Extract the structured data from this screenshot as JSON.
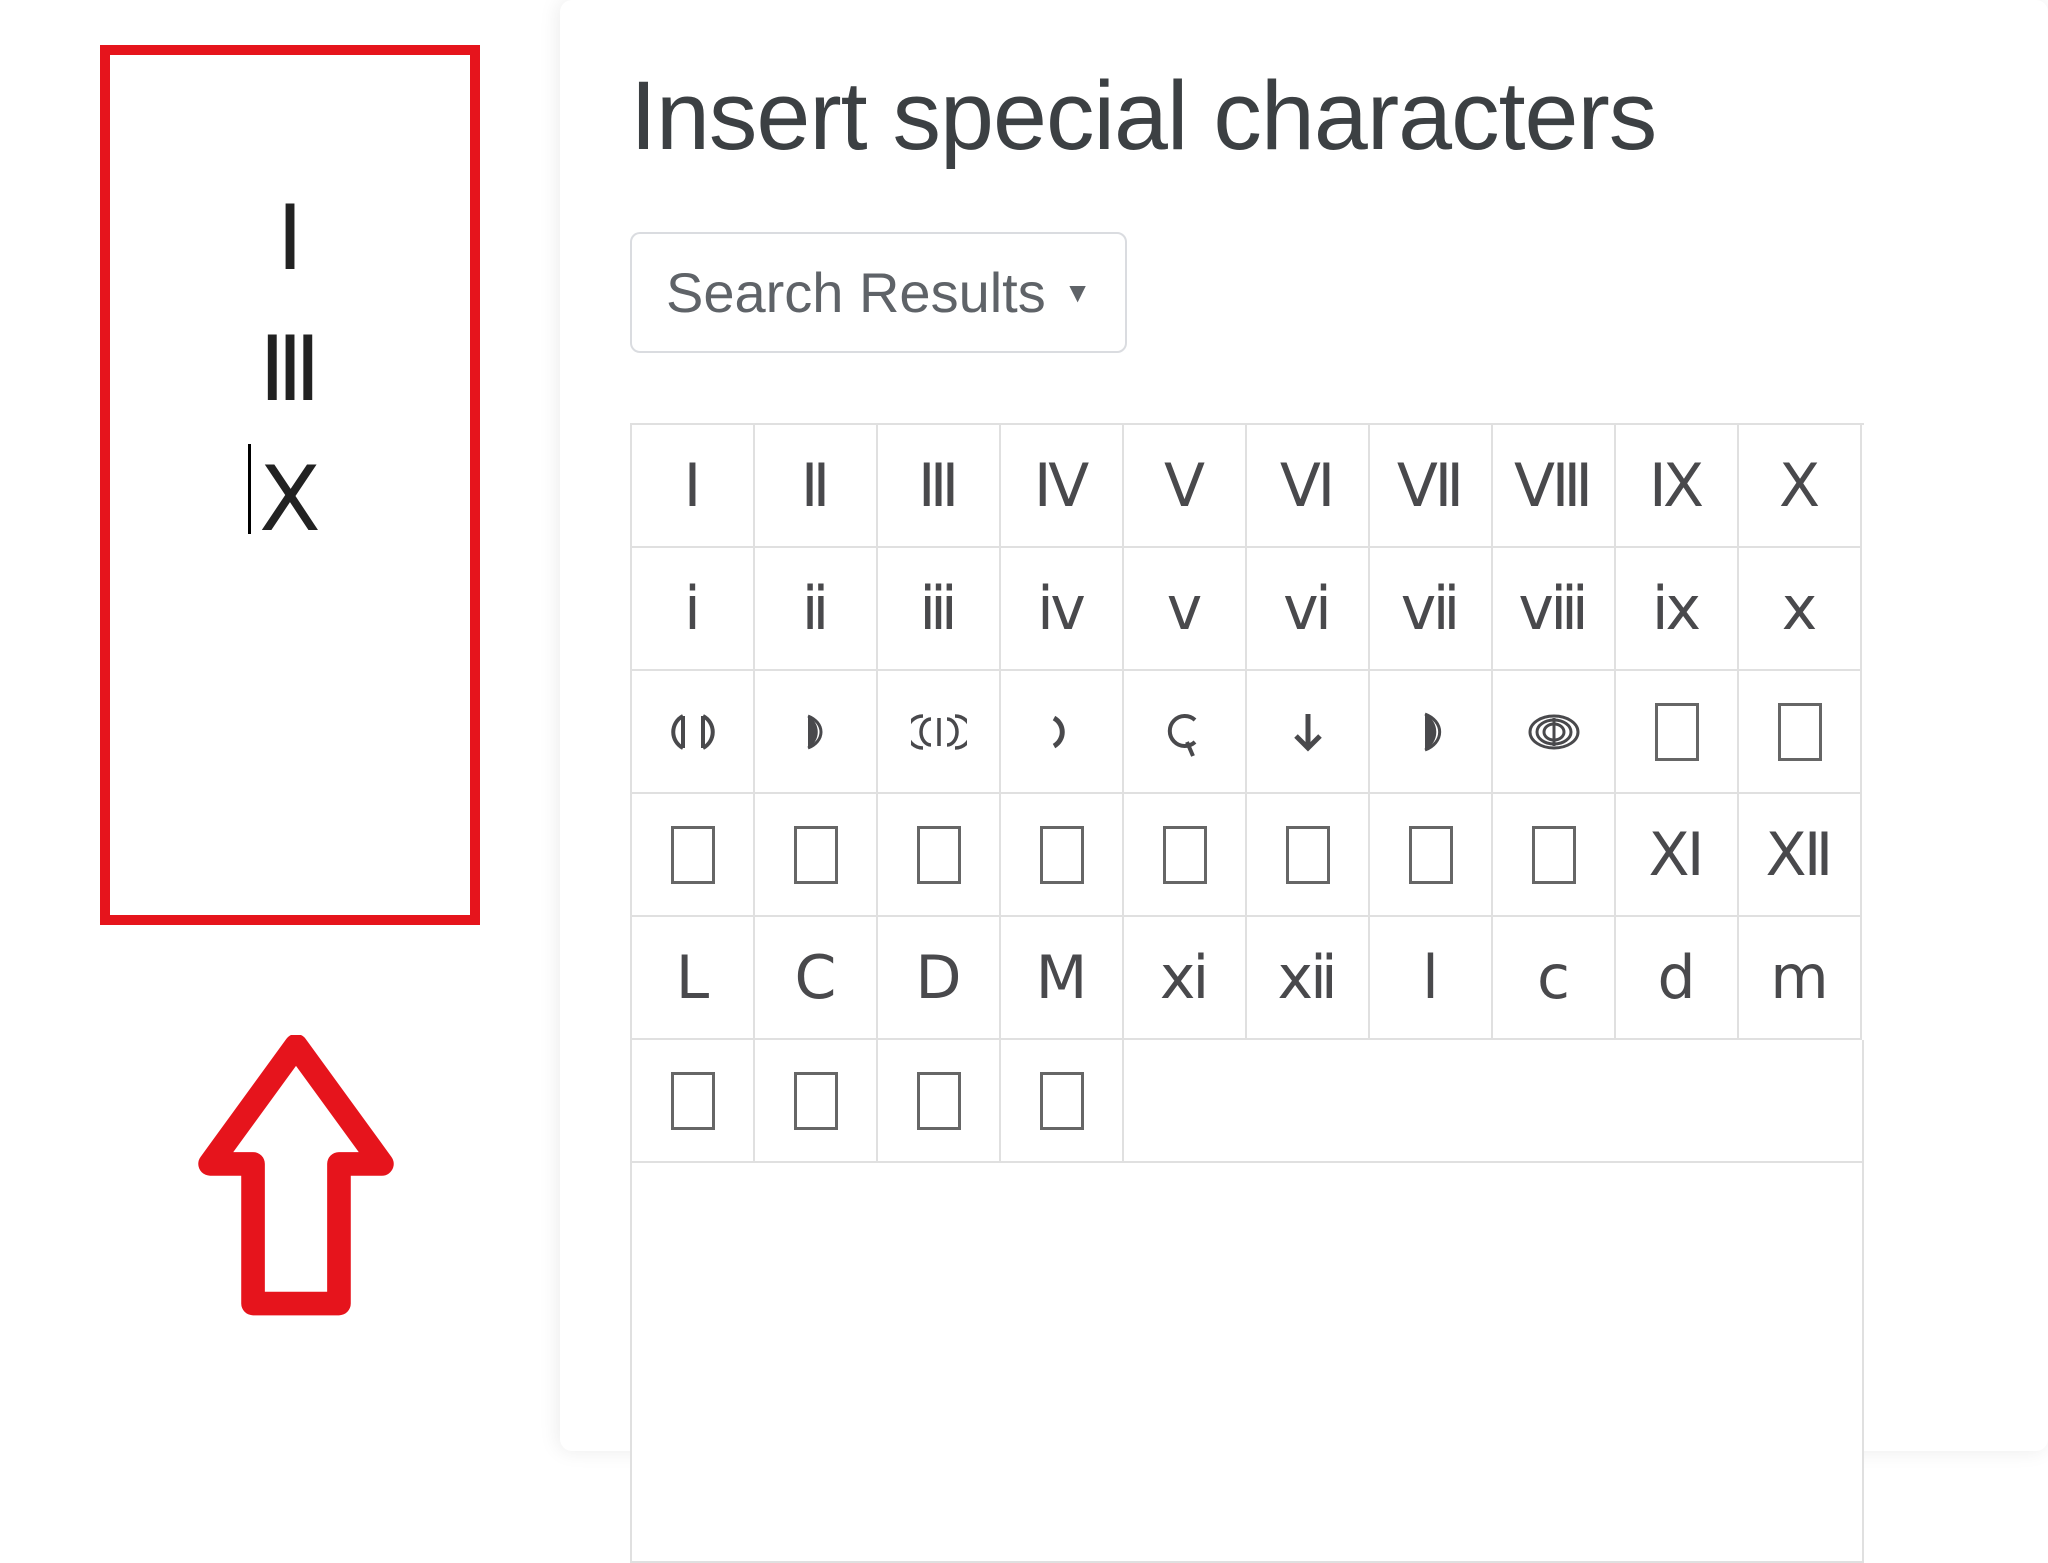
{
  "document": {
    "lines": [
      "Ⅰ",
      "Ⅲ",
      "Ⅹ"
    ]
  },
  "dialog": {
    "title": "Insert special characters",
    "category_label": "Search Results",
    "grid": [
      [
        {
          "g": "Ⅰ",
          "n": "roman-numeral-one"
        },
        {
          "g": "Ⅱ",
          "n": "roman-numeral-two"
        },
        {
          "g": "Ⅲ",
          "n": "roman-numeral-three"
        },
        {
          "g": "Ⅳ",
          "n": "roman-numeral-four"
        },
        {
          "g": "Ⅴ",
          "n": "roman-numeral-five"
        },
        {
          "g": "Ⅵ",
          "n": "roman-numeral-six"
        },
        {
          "g": "Ⅶ",
          "n": "roman-numeral-seven"
        },
        {
          "g": "Ⅷ",
          "n": "roman-numeral-eight"
        },
        {
          "g": "Ⅸ",
          "n": "roman-numeral-nine"
        },
        {
          "g": "Ⅹ",
          "n": "roman-numeral-ten"
        }
      ],
      [
        {
          "g": "ⅰ",
          "n": "small-roman-numeral-one"
        },
        {
          "g": "ⅱ",
          "n": "small-roman-numeral-two"
        },
        {
          "g": "ⅲ",
          "n": "small-roman-numeral-three"
        },
        {
          "g": "ⅳ",
          "n": "small-roman-numeral-four"
        },
        {
          "g": "ⅴ",
          "n": "small-roman-numeral-five"
        },
        {
          "g": "ⅵ",
          "n": "small-roman-numeral-six"
        },
        {
          "g": "ⅶ",
          "n": "small-roman-numeral-seven"
        },
        {
          "g": "ⅷ",
          "n": "small-roman-numeral-eight"
        },
        {
          "g": "ⅸ",
          "n": "small-roman-numeral-nine"
        },
        {
          "g": "ⅹ",
          "n": "small-roman-numeral-ten"
        }
      ],
      [
        {
          "svg": "cd",
          "n": "roman-numeral-one-hundred-thousand"
        },
        {
          "svg": "halfmoon",
          "n": "roman-numeral-five-thousand"
        },
        {
          "svg": "double-cd",
          "n": "roman-numeral-ten-thousand"
        },
        {
          "svg": "reverse-c",
          "n": "roman-numeral-reversed-hundred"
        },
        {
          "svg": "c-tail",
          "n": "roman-siliqua-sign"
        },
        {
          "svg": "down-arrow",
          "n": "roman-quinarius-sign"
        },
        {
          "svg": "halfmoon-dark",
          "n": "roman-numeral-fifty-thousand"
        },
        {
          "svg": "triple-cd",
          "n": "roman-numeral-one-hundred-thousand-alt"
        },
        {
          "tofu": true,
          "n": "unknown-glyph-1"
        },
        {
          "tofu": true,
          "n": "unknown-glyph-2"
        }
      ],
      [
        {
          "tofu": true,
          "n": "unknown-glyph-3"
        },
        {
          "tofu": true,
          "n": "unknown-glyph-4"
        },
        {
          "tofu": true,
          "n": "unknown-glyph-5"
        },
        {
          "tofu": true,
          "n": "unknown-glyph-6"
        },
        {
          "tofu": true,
          "n": "unknown-glyph-7"
        },
        {
          "tofu": true,
          "n": "unknown-glyph-8"
        },
        {
          "tofu": true,
          "n": "unknown-glyph-9"
        },
        {
          "tofu": true,
          "n": "unknown-glyph-10"
        },
        {
          "g": "Ⅺ",
          "n": "roman-numeral-eleven"
        },
        {
          "g": "Ⅻ",
          "n": "roman-numeral-twelve"
        }
      ],
      [
        {
          "g": "Ⅼ",
          "n": "roman-numeral-fifty"
        },
        {
          "g": "Ⅽ",
          "n": "roman-numeral-one-hundred"
        },
        {
          "g": "Ⅾ",
          "n": "roman-numeral-five-hundred"
        },
        {
          "g": "Ⅿ",
          "n": "roman-numeral-one-thousand"
        },
        {
          "g": "ⅺ",
          "n": "small-roman-numeral-eleven"
        },
        {
          "g": "ⅻ",
          "n": "small-roman-numeral-twelve"
        },
        {
          "g": "ⅼ",
          "n": "small-roman-numeral-fifty"
        },
        {
          "g": "ⅽ",
          "n": "small-roman-numeral-one-hundred"
        },
        {
          "g": "ⅾ",
          "n": "small-roman-numeral-five-hundred"
        },
        {
          "g": "ⅿ",
          "n": "small-roman-numeral-one-thousand"
        }
      ],
      [
        {
          "tofu": true,
          "n": "unknown-glyph-11"
        },
        {
          "tofu": true,
          "n": "unknown-glyph-12"
        },
        {
          "tofu": true,
          "n": "unknown-glyph-13"
        },
        {
          "tofu": true,
          "n": "unknown-glyph-14"
        }
      ]
    ]
  },
  "annotation": {
    "box_color": "#e6141c"
  }
}
